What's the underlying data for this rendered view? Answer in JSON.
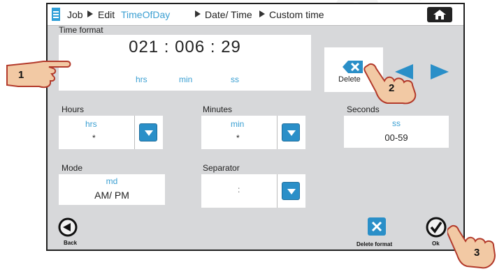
{
  "breadcrumb": {
    "items": [
      "Job",
      "Edit",
      "TimeOfDay",
      "Date/ Time",
      "Custom time"
    ]
  },
  "time_format": {
    "label": "Time format",
    "value": "021 : 006 : 29",
    "units": [
      "hrs",
      "min",
      "ss"
    ]
  },
  "delete_button": {
    "label": "Delete"
  },
  "hours": {
    "label": "Hours",
    "code": "hrs",
    "value": "*"
  },
  "minutes": {
    "label": "Minutes",
    "code": "min",
    "value": "*"
  },
  "seconds": {
    "label": "Seconds",
    "code": "ss",
    "value": "00-59"
  },
  "mode": {
    "label": "Mode",
    "code": "md",
    "value": "AM/ PM"
  },
  "separator": {
    "label": "Separator",
    "value": ":"
  },
  "footer": {
    "back_label": "Back",
    "delete_format_label": "Delete format",
    "ok_label": "Ok"
  },
  "callouts": [
    "1",
    "2",
    "3"
  ],
  "colors": {
    "accent": "#3a9fd2",
    "button_blue": "#2a8fc8",
    "screen_bg": "#d7d8da"
  },
  "icons": {
    "breadcrumb": "document-icon",
    "home": "home-icon",
    "delete": "backspace-icon",
    "prev": "arrow-left-icon",
    "next": "arrow-right-icon",
    "back": "back-icon",
    "delete_format": "delete-format-icon",
    "ok": "checkmark-icon"
  }
}
